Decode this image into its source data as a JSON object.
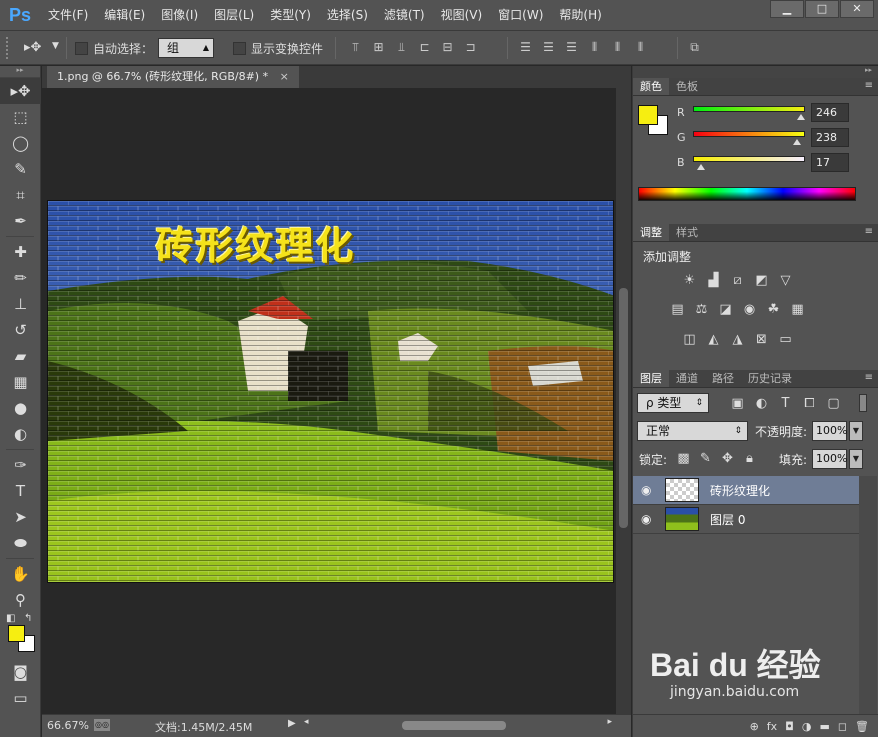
{
  "app": {
    "logo": "Ps"
  },
  "menu": [
    "文件(F)",
    "编辑(E)",
    "图像(I)",
    "图层(L)",
    "类型(Y)",
    "选择(S)",
    "滤镜(T)",
    "视图(V)",
    "窗口(W)",
    "帮助(H)"
  ],
  "window_controls": {
    "minimize": "▁",
    "maximize": "□",
    "close": "✕"
  },
  "options": {
    "auto_select_label": "自动选择：",
    "auto_select_value": "组",
    "show_transform_label": "显示变换控件"
  },
  "document": {
    "tab_title": "1.png @ 66.7% (砖形纹理化, RGB/8#) *",
    "close": "×",
    "image_text": "砖形纹理化"
  },
  "status": {
    "zoom": "66.67%",
    "doc_info": "文档:1.45M/2.45M"
  },
  "colors": {
    "foreground": "#f6ee11",
    "background": "#ffffff",
    "accent": "#4aa8ff",
    "selected_layer": "#6f7d96"
  },
  "color_panel": {
    "tabs": [
      "颜色",
      "色板"
    ],
    "channels": [
      {
        "label": "R",
        "value": "246",
        "fraction": 0.965
      },
      {
        "label": "G",
        "value": "238",
        "fraction": 0.933
      },
      {
        "label": "B",
        "value": "17",
        "fraction": 0.067
      }
    ]
  },
  "adjustments": {
    "tabs": [
      "调整",
      "样式"
    ],
    "title": "添加调整"
  },
  "layers_panel": {
    "tabs": [
      "图层",
      "通道",
      "路径",
      "历史记录"
    ],
    "filter_kind": "ρ 类型",
    "blend_mode": "正常",
    "opacity_label": "不透明度:",
    "opacity_value": "100%",
    "lock_label": "锁定:",
    "fill_label": "填充:",
    "fill_value": "100%",
    "layers": [
      {
        "name": "砖形纹理化",
        "selected": true,
        "thumb": "transparent"
      },
      {
        "name": "图层 0",
        "selected": false,
        "thumb": "landscape"
      }
    ]
  },
  "watermark": {
    "main": "Bai du 经验",
    "sub": "jingyan.baidu.com"
  }
}
